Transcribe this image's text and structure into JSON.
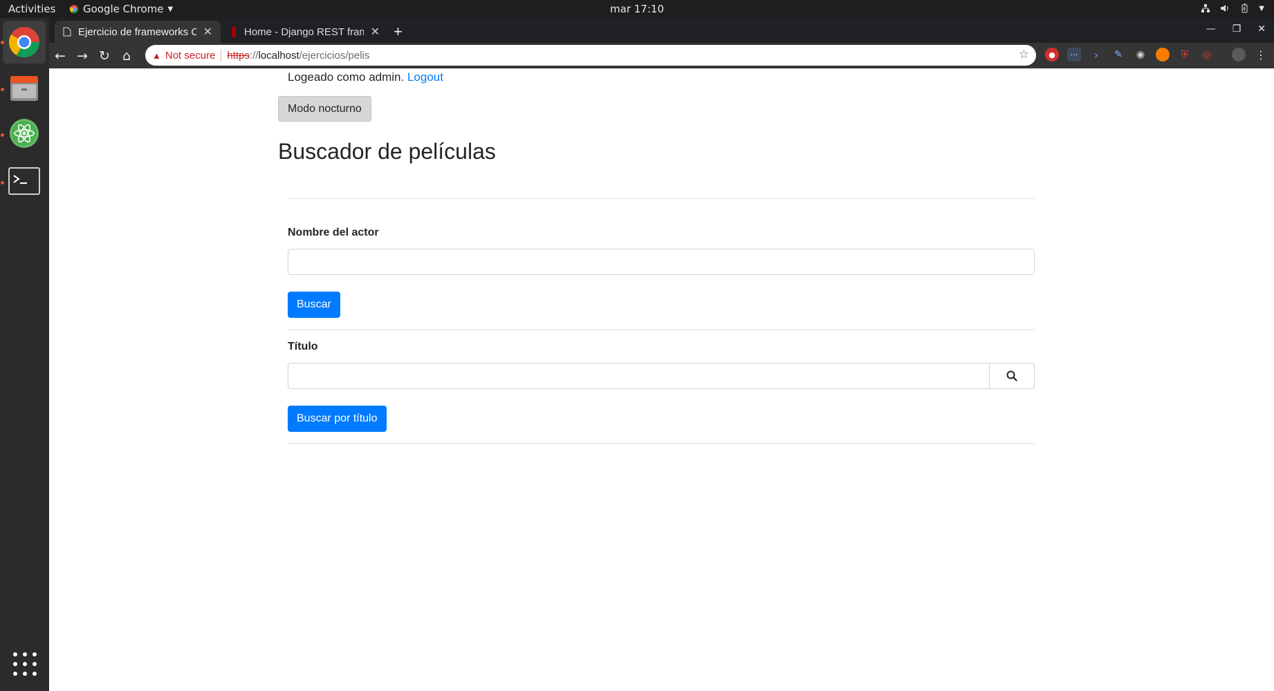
{
  "topbar": {
    "activities": "Activities",
    "app_name": "Google Chrome",
    "clock": "mar 17:10"
  },
  "dock": {
    "items": [
      "chrome-icon",
      "files-icon",
      "atom-icon",
      "terminal-icon"
    ],
    "show_apps": "apps-grid-icon"
  },
  "browser": {
    "tabs": [
      {
        "title": "Ejercicio de frameworks C",
        "active": true
      },
      {
        "title": "Home - Django REST fram",
        "active": false
      }
    ],
    "url": {
      "warning": "Not secure",
      "protocol": "https",
      "separator": "://",
      "host": "localhost",
      "path": "/ejercicios/pelis"
    },
    "extensions": [
      "ext-red",
      "ext-dots",
      "ext-arrow",
      "ext-pen",
      "ext-camera",
      "ext-orange",
      "ext-shield",
      "ext-target",
      "profile-avatar",
      "menu"
    ]
  },
  "page": {
    "login_text": "Logeado como admin.",
    "logout_label": "Logout",
    "night_mode_label": "Modo nocturno",
    "heading": "Buscador de películas",
    "actor_label": "Nombre del actor",
    "actor_value": "",
    "search_label": "Buscar",
    "title_label": "Título",
    "title_value": "",
    "search_title_label": "Buscar por título"
  },
  "colors": {
    "primary": "#007bff",
    "link": "#007bff",
    "night_btn": "#d6d6d6",
    "ubuntu_orange": "#e95420",
    "not_secure": "#c5221f"
  }
}
